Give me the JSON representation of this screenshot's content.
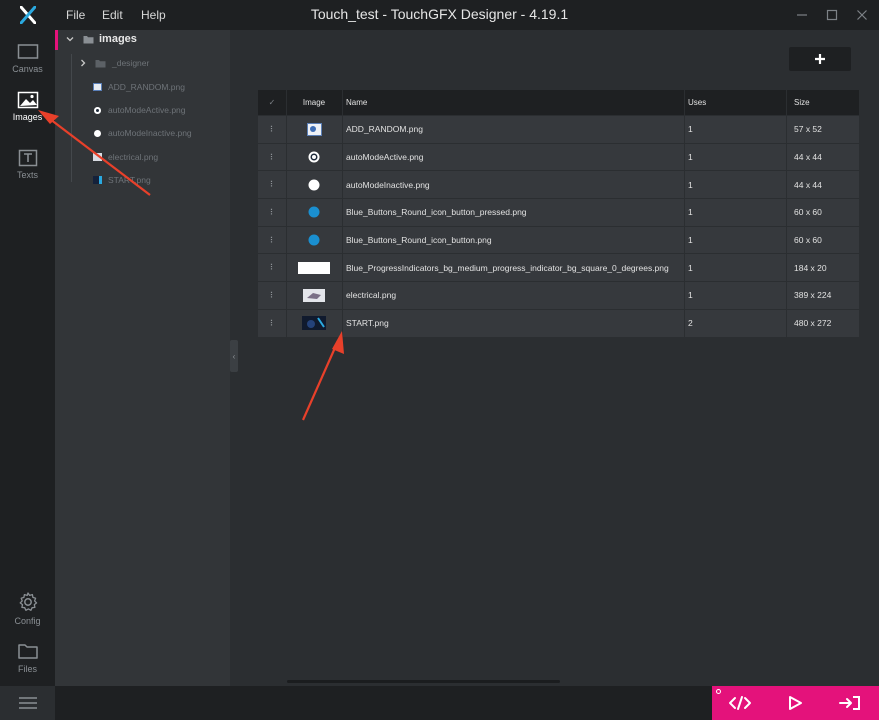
{
  "window": {
    "title": "Touch_test - TouchGFX Designer - 4.19.1",
    "menu": [
      {
        "label": "File"
      },
      {
        "label": "Edit"
      },
      {
        "label": "Help"
      }
    ]
  },
  "nav": {
    "canvas": "Canvas",
    "images": "Images",
    "texts": "Texts",
    "config": "Config",
    "files": "Files",
    "active": "images"
  },
  "tree": {
    "root": "images",
    "items": [
      {
        "label": "_designer",
        "type": "folder"
      },
      {
        "label": "ADD_RANDOM.png",
        "type": "image"
      },
      {
        "label": "autoModeActive.png",
        "type": "image"
      },
      {
        "label": "autoModeInactive.png",
        "type": "image"
      },
      {
        "label": "electrical.png",
        "type": "image"
      },
      {
        "label": "START.png",
        "type": "image"
      }
    ]
  },
  "table": {
    "headers": {
      "check": "✓",
      "image": "Image",
      "name": "Name",
      "uses": "Uses",
      "size": "Size"
    },
    "rows": [
      {
        "name": "ADD_RANDOM.png",
        "uses": "1",
        "size": "57 x 52",
        "thumb": "add-random"
      },
      {
        "name": "autoModeActive.png",
        "uses": "1",
        "size": "44 x 44",
        "thumb": "ring"
      },
      {
        "name": "autoModeInactive.png",
        "uses": "1",
        "size": "44 x 44",
        "thumb": "white-dot"
      },
      {
        "name": "Blue_Buttons_Round_icon_button_pressed.png",
        "uses": "1",
        "size": "60 x 60",
        "thumb": "blue-dot"
      },
      {
        "name": "Blue_Buttons_Round_icon_button.png",
        "uses": "1",
        "size": "60 x 60",
        "thumb": "blue-dot"
      },
      {
        "name": "Blue_ProgressIndicators_bg_medium_progress_indicator_bg_square_0_degrees.png",
        "uses": "1",
        "size": "184 x 20",
        "thumb": "white-bar"
      },
      {
        "name": "electrical.png",
        "uses": "1",
        "size": "389 x 224",
        "thumb": "electrical"
      },
      {
        "name": "START.png",
        "uses": "2",
        "size": "480 x 272",
        "thumb": "start"
      }
    ]
  },
  "colors": {
    "accent": "#e4127b",
    "annotation": "#e8402a",
    "blue_button": "#1a8fd0"
  },
  "icons": {
    "logo": "touchgfx-logo-icon",
    "add": "plus-icon",
    "code": "code-icon",
    "run": "play-icon",
    "publish": "export-icon"
  }
}
